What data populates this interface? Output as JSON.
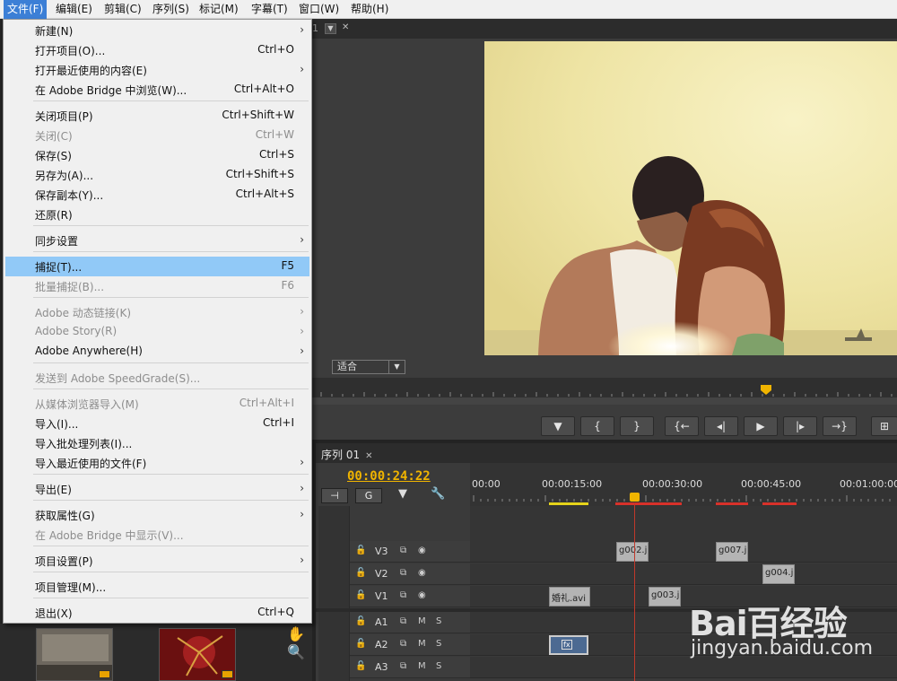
{
  "menubar": {
    "items": [
      "文件(F)",
      "编辑(E)",
      "剪辑(C)",
      "序列(S)",
      "标记(M)",
      "字幕(T)",
      "窗口(W)",
      "帮助(H)"
    ],
    "active_index": 0
  },
  "file_menu": {
    "items": [
      {
        "label": "新建(N)",
        "shortcut": "",
        "submenu": true,
        "disabled": false
      },
      {
        "label": "打开项目(O)...",
        "shortcut": "Ctrl+O",
        "submenu": false,
        "disabled": false
      },
      {
        "label": "打开最近使用的内容(E)",
        "shortcut": "",
        "submenu": true,
        "disabled": false
      },
      {
        "label": "在 Adobe Bridge 中浏览(W)...",
        "shortcut": "Ctrl+Alt+O",
        "submenu": false,
        "disabled": false
      },
      {
        "label": "关闭项目(P)",
        "shortcut": "Ctrl+Shift+W",
        "submenu": false,
        "disabled": false
      },
      {
        "label": "关闭(C)",
        "shortcut": "Ctrl+W",
        "submenu": false,
        "disabled": true
      },
      {
        "label": "保存(S)",
        "shortcut": "Ctrl+S",
        "submenu": false,
        "disabled": false
      },
      {
        "label": "另存为(A)...",
        "shortcut": "Ctrl+Shift+S",
        "submenu": false,
        "disabled": false
      },
      {
        "label": "保存副本(Y)...",
        "shortcut": "Ctrl+Alt+S",
        "submenu": false,
        "disabled": false
      },
      {
        "label": "还原(R)",
        "shortcut": "",
        "submenu": false,
        "disabled": false
      },
      {
        "label": "同步设置",
        "shortcut": "",
        "submenu": true,
        "disabled": false
      },
      {
        "label": "捕捉(T)...",
        "shortcut": "F5",
        "submenu": false,
        "disabled": false,
        "highlighted": true
      },
      {
        "label": "批量捕捉(B)...",
        "shortcut": "F6",
        "submenu": false,
        "disabled": true
      },
      {
        "label": "Adobe 动态链接(K)",
        "shortcut": "",
        "submenu": true,
        "disabled": true
      },
      {
        "label": "Adobe Story(R)",
        "shortcut": "",
        "submenu": true,
        "disabled": true
      },
      {
        "label": "Adobe Anywhere(H)",
        "shortcut": "",
        "submenu": true,
        "disabled": false
      },
      {
        "label": "发送到 Adobe SpeedGrade(S)...",
        "shortcut": "",
        "submenu": false,
        "disabled": true
      },
      {
        "label": "从媒体浏览器导入(M)",
        "shortcut": "Ctrl+Alt+I",
        "submenu": false,
        "disabled": true
      },
      {
        "label": "导入(I)...",
        "shortcut": "Ctrl+I",
        "submenu": false,
        "disabled": false
      },
      {
        "label": "导入批处理列表(I)...",
        "shortcut": "",
        "submenu": false,
        "disabled": false
      },
      {
        "label": "导入最近使用的文件(F)",
        "shortcut": "",
        "submenu": true,
        "disabled": false
      },
      {
        "label": "导出(E)",
        "shortcut": "",
        "submenu": true,
        "disabled": false
      },
      {
        "label": "获取属性(G)",
        "shortcut": "",
        "submenu": true,
        "disabled": false
      },
      {
        "label": "在 Adobe Bridge 中显示(V)...",
        "shortcut": "",
        "submenu": false,
        "disabled": true
      },
      {
        "label": "项目设置(P)",
        "shortcut": "",
        "submenu": true,
        "disabled": false
      },
      {
        "label": "项目管理(M)...",
        "shortcut": "",
        "submenu": false,
        "disabled": false
      },
      {
        "label": "退出(X)",
        "shortcut": "Ctrl+Q",
        "submenu": false,
        "disabled": false
      }
    ]
  },
  "program_monitor": {
    "tab_number": "1",
    "fit_value": "适合"
  },
  "timeline": {
    "tab_label": "序列 01",
    "timecode": "00:00:24:22",
    "ruler_labels": [
      "00:00",
      "00:00:15:00",
      "00:00:30:00",
      "00:00:45:00",
      "00:01:00:00"
    ],
    "tracks": [
      {
        "name": "V3",
        "type": "video"
      },
      {
        "name": "V2",
        "type": "video"
      },
      {
        "name": "V1",
        "type": "video"
      },
      {
        "name": "A1",
        "type": "audio"
      },
      {
        "name": "A2",
        "type": "audio"
      },
      {
        "name": "A3",
        "type": "audio"
      }
    ],
    "clips": {
      "v3_a": "g002.j",
      "v3_b": "g007.j",
      "v2_a": "g004.j",
      "v1_a": "婚礼.avi",
      "v1_b": "g003.j",
      "a2_fx": "fx"
    },
    "audio_mute": "M",
    "audio_solo": "S"
  },
  "watermark": {
    "brand": "Bai百经验",
    "url": "jingyan.baidu.com"
  },
  "colors": {
    "menu_highlight": "#91c9f7",
    "timecode": "#f0b400",
    "playhead": "#c0392b"
  }
}
